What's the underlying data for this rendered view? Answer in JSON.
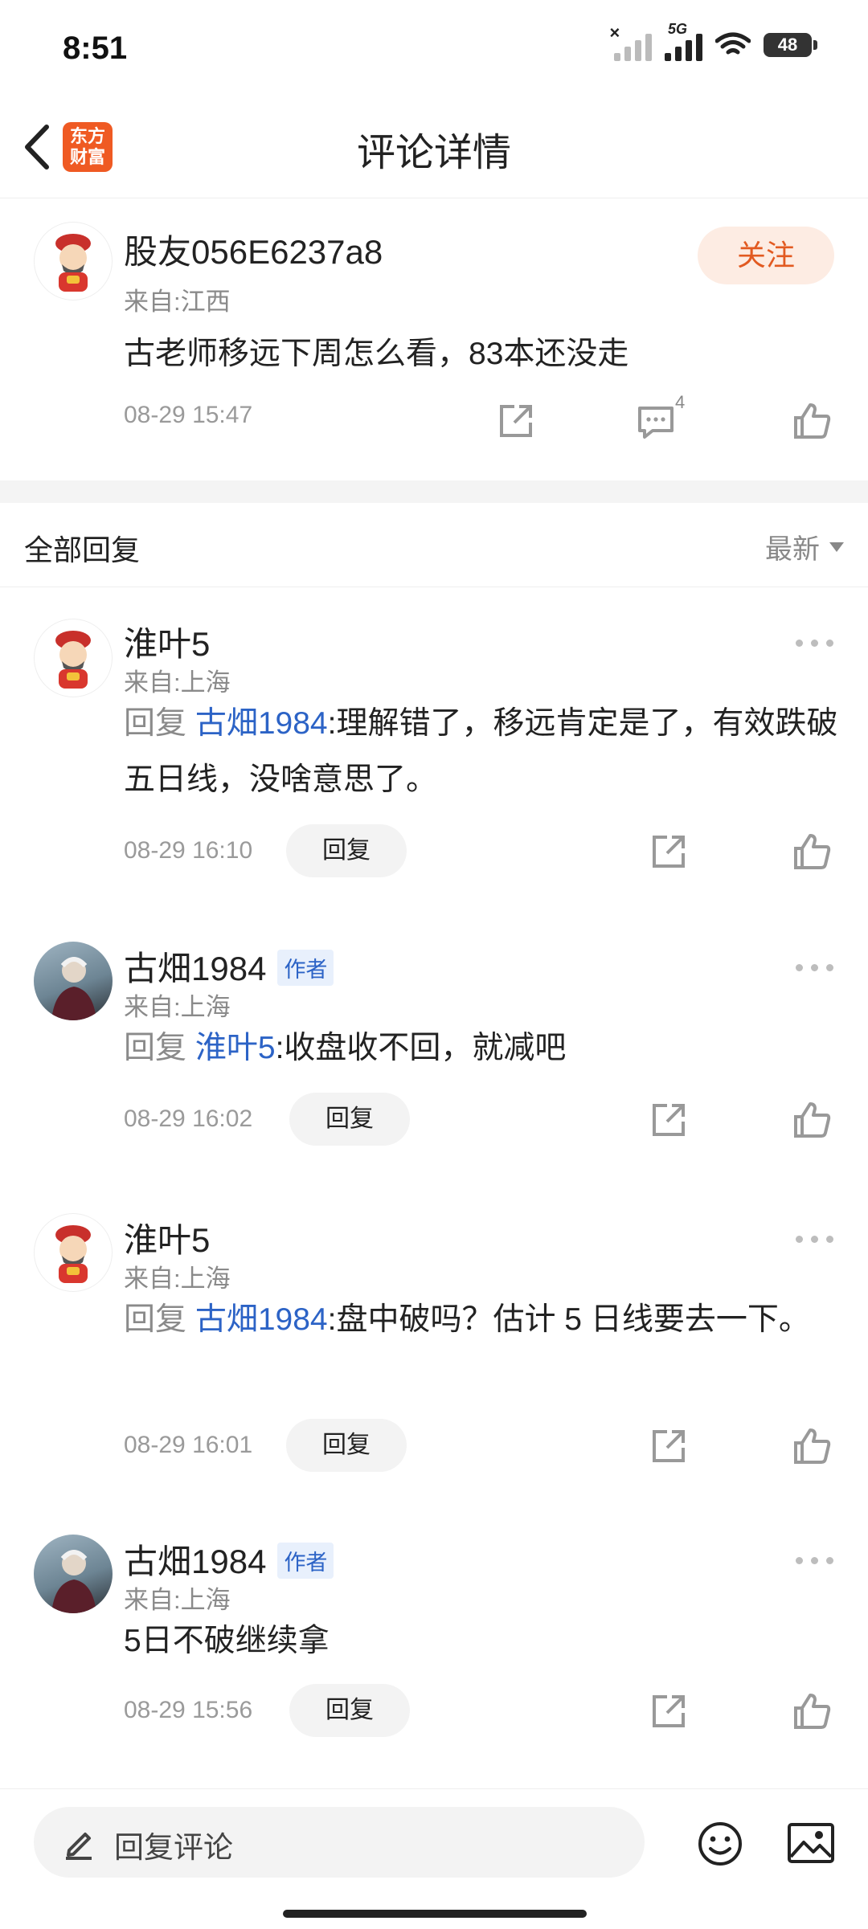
{
  "status_bar": {
    "time": "8:51",
    "network": "5G",
    "battery": "48"
  },
  "header": {
    "title": "评论详情",
    "logo_text": "东方财富"
  },
  "post": {
    "username": "股友056E6237a8",
    "location": "来自:江西",
    "content": "古老师移远下周怎么看，83本还没走",
    "time": "08-29 15:47",
    "follow_label": "关注",
    "comment_count": "4"
  },
  "section": {
    "title": "全部回复",
    "sort_label": "最新"
  },
  "replies": [
    {
      "username": "淮叶5",
      "location": "来自:上海",
      "is_author": false,
      "reply_prefix": "回复",
      "reply_to": "古畑1984",
      "text": ":理解错了，移远肯定是了，有效跌破五日线，没啥意思了。",
      "time": "08-29 16:10",
      "reply_label": "回复"
    },
    {
      "username": "古畑1984",
      "author_tag": "作者",
      "location": "来自:上海",
      "is_author": true,
      "reply_prefix": "回复",
      "reply_to": "淮叶5",
      "text": ":收盘收不回，就减吧",
      "time": "08-29 16:02",
      "reply_label": "回复"
    },
    {
      "username": "淮叶5",
      "location": "来自:上海",
      "is_author": false,
      "reply_prefix": "回复",
      "reply_to": "古畑1984",
      "text": ":盘中破吗？估计 5 日线要去一下。",
      "time": "08-29 16:01",
      "reply_label": "回复"
    },
    {
      "username": "古畑1984",
      "author_tag": "作者",
      "location": "来自:上海",
      "is_author": true,
      "text": "5日不破继续拿",
      "time": "08-29 15:56",
      "reply_label": "回复"
    }
  ],
  "bottom_bar": {
    "input_placeholder": "回复评论"
  },
  "icons": {
    "back": "chevron-left-icon",
    "share": "share-icon",
    "comment": "comment-icon",
    "like": "thumbs-up-icon",
    "more": "more-icon",
    "pen": "pen-icon",
    "emoji": "emoji-icon",
    "image": "image-icon"
  },
  "colors": {
    "brand": "#ef5a23",
    "link": "#2c63c6",
    "follow_bg": "#fdece3"
  }
}
